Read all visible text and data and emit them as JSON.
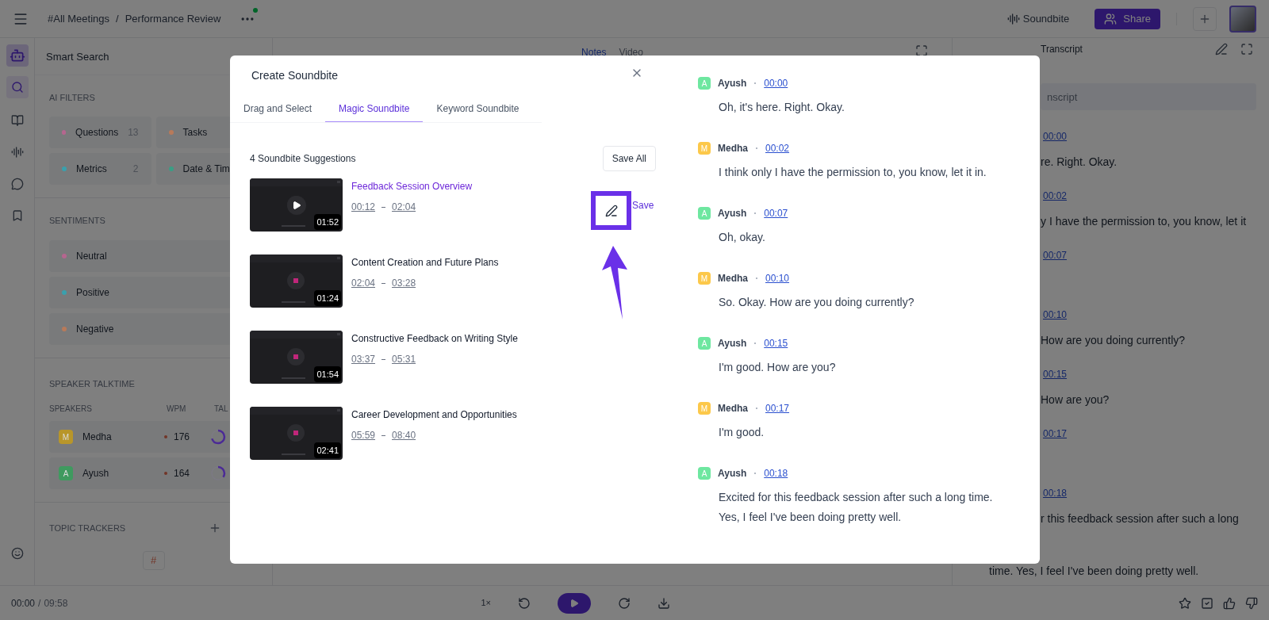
{
  "topbar": {
    "breadcrumb": [
      "#All Meetings",
      "Performance Review"
    ],
    "separator": "/",
    "soundbite": "Soundbite",
    "share": "Share"
  },
  "left_panel": {
    "title": "Smart Search",
    "ai_filters": {
      "heading": "AI FILTERS",
      "items": [
        {
          "label": "Questions",
          "count": "13",
          "color": "#b5668f"
        },
        {
          "label": "Tasks",
          "color": "#b87a5a"
        },
        {
          "label": "Metrics",
          "count": "2",
          "color": "#3aa0ad"
        },
        {
          "label": "Date & Tim",
          "color": "#3a9e85"
        }
      ]
    },
    "sentiments": {
      "heading": "SENTIMENTS",
      "items": [
        {
          "label": "Neutral",
          "color": "#b5668f"
        },
        {
          "label": "Positive",
          "color": "#3aa0ad"
        },
        {
          "label": "Negative",
          "color": "#b87a5a"
        }
      ]
    },
    "talktime": {
      "heading": "SPEAKER TALKTIME",
      "columns": [
        "SPEAKERS",
        "WPM",
        "TAL"
      ],
      "speakers": [
        {
          "initial": "M",
          "name": "Medha",
          "wpm": "176",
          "level": 0.7,
          "color": "#b8962a"
        },
        {
          "initial": "A",
          "name": "Ayush",
          "wpm": "164",
          "level": 0.35,
          "color": "#3f9a5f"
        }
      ]
    },
    "topic_trackers": {
      "heading": "TOPIC TRACKERS",
      "tag": "#"
    }
  },
  "center_tabs": [
    {
      "label": "Notes",
      "selected": true
    },
    {
      "label": "Video",
      "selected": false
    }
  ],
  "transcript_panel": {
    "title": "Transcript",
    "placeholder": "nscript",
    "entries": [
      {
        "time": "00:00",
        "text": "re. Right. Okay."
      },
      {
        "time": "00:02",
        "text": "y I have the permission to, you know, let it"
      },
      {
        "time": "00:07"
      },
      {
        "time": "00:10",
        "text": "How are you doing currently?"
      },
      {
        "time": "00:15",
        "text": "How are you?"
      },
      {
        "time": "00:17"
      },
      {
        "time": "00:18",
        "text": "r this feedback session after such a long"
      }
    ],
    "last_line": "time. Yes, I feel I've been doing pretty well."
  },
  "player": {
    "current": "00:00",
    "separator": "/",
    "total": "09:58",
    "speed": "1×"
  },
  "modal": {
    "title": "Create Soundbite",
    "tabs": [
      {
        "label": "Drag and Select",
        "selected": false
      },
      {
        "label": "Magic Soundbite",
        "selected": true
      },
      {
        "label": "Keyword Soundbite",
        "selected": false
      }
    ],
    "count_label": "4 Soundbite Suggestions",
    "save_all": "Save All",
    "save": "Save",
    "suggestions": [
      {
        "title": "Feedback Session Overview",
        "start": "00:12",
        "end": "02:04",
        "duration": "01:52",
        "selected": true
      },
      {
        "title": "Content Creation and Future Plans",
        "start": "02:04",
        "end": "03:28",
        "duration": "01:24",
        "selected": false
      },
      {
        "title": "Constructive Feedback on Writing Style",
        "start": "03:37",
        "end": "05:31",
        "duration": "01:54",
        "selected": false
      },
      {
        "title": "Career Development and Opportunities",
        "start": "05:59",
        "end": "08:40",
        "duration": "02:41",
        "selected": false
      }
    ],
    "transcript": [
      {
        "initial": "A",
        "speaker": "Ayush",
        "time": "00:00",
        "text": "Oh, it's here. Right. Okay.",
        "color": "#6ee7a0"
      },
      {
        "initial": "M",
        "speaker": "Medha",
        "time": "00:02",
        "text": "I think only I have the permission to, you know, let it in.",
        "color": "#fcc84a"
      },
      {
        "initial": "A",
        "speaker": "Ayush",
        "time": "00:07",
        "text": "Oh, okay.",
        "color": "#6ee7a0"
      },
      {
        "initial": "M",
        "speaker": "Medha",
        "time": "00:10",
        "text": "So. Okay. How are you doing currently?",
        "color": "#fcc84a"
      },
      {
        "initial": "A",
        "speaker": "Ayush",
        "time": "00:15",
        "text": "I'm good. How are you?",
        "color": "#6ee7a0"
      },
      {
        "initial": "M",
        "speaker": "Medha",
        "time": "00:17",
        "text": "I'm good.",
        "color": "#fcc84a"
      },
      {
        "initial": "A",
        "speaker": "Ayush",
        "time": "00:18",
        "text": "Excited for this feedback session after such a long time. Yes, I feel I've been doing pretty well.",
        "color": "#6ee7a0"
      }
    ]
  }
}
